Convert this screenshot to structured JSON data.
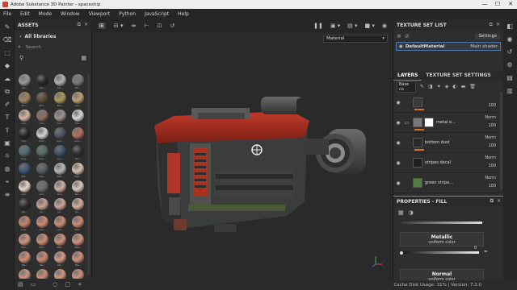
{
  "window": {
    "title": "Adobe Substance 3D Painter - spaceship",
    "min": "—",
    "max": "☐",
    "close": "✕"
  },
  "menu": [
    "File",
    "Edit",
    "Mode",
    "Window",
    "Viewport",
    "Python",
    "JavaScript",
    "Help"
  ],
  "assets": {
    "title": "ASSETS",
    "library": "All libraries",
    "search_placeholder": "Search",
    "items": [
      {
        "label": "Alu...",
        "color": "#9a9a9a"
      },
      {
        "label": "Alu...",
        "color": "#2a2a2a"
      },
      {
        "label": "Alu...",
        "color": "#b0b0b0"
      },
      {
        "label": "Alu...",
        "color": "#7c7c7c"
      },
      {
        "label": "Bro...",
        "color": "#a4855d"
      },
      {
        "label": "Bro...",
        "color": "#5a4a36"
      },
      {
        "label": "Bro...",
        "color": "#a89a55"
      },
      {
        "label": "Car...",
        "color": "#c0a070"
      },
      {
        "label": "Car...",
        "color": "#d6b8a3"
      },
      {
        "label": "Cel...",
        "color": "#8c6f62"
      },
      {
        "label": "Cel...",
        "color": "#9d938e"
      },
      {
        "label": "Chr...",
        "color": "#d8d8d8"
      },
      {
        "label": "Chr...",
        "color": "#272727"
      },
      {
        "label": "Cob...",
        "color": "#d2d2d2"
      },
      {
        "label": "Cob...",
        "color": "#4d5463"
      },
      {
        "label": "Cop...",
        "color": "#b0705c"
      },
      {
        "label": "Cop...",
        "color": "#4e6c74"
      },
      {
        "label": "Cop...",
        "color": "#556b66"
      },
      {
        "label": "Cyc...",
        "color": "#3c5468"
      },
      {
        "label": "Dir...",
        "color": "#2f3033"
      },
      {
        "label": "Ele...",
        "color": "#3d5775"
      },
      {
        "label": "Fab...",
        "color": "#5a5d60"
      },
      {
        "label": "Fab...",
        "color": "#b9b9b9"
      },
      {
        "label": "Fab...",
        "color": "#d5c1b0"
      },
      {
        "label": "Gla...",
        "color": "#e9d5c8"
      },
      {
        "label": "Gol...",
        "color": "#6e6e6e"
      },
      {
        "label": "Gol...",
        "color": "#cfaea0"
      },
      {
        "label": "Gri...",
        "color": "#d9c6bc"
      },
      {
        "label": "Gri...",
        "color": "#2c2c2c"
      },
      {
        "label": "Iro...",
        "color": "#c8a28f"
      },
      {
        "label": "Iro...",
        "color": "#cba696"
      },
      {
        "label": "Iro...",
        "color": "#d3ae99"
      },
      {
        "label": "Lea...",
        "color": "#c98268"
      },
      {
        "label": "Lea...",
        "color": "#d08a71"
      },
      {
        "label": "Lea...",
        "color": "#cf8b72"
      },
      {
        "label": "Met...",
        "color": "#c98a73"
      },
      {
        "label": "Met...",
        "color": "#d0957e"
      },
      {
        "label": "Met...",
        "color": "#cd8c73"
      },
      {
        "label": "Met...",
        "color": "#cf9179"
      },
      {
        "label": "Met...",
        "color": "#d19681"
      },
      {
        "label": "Pai...",
        "color": "#d08e75"
      },
      {
        "label": "Pai...",
        "color": "#c88970"
      },
      {
        "label": "Pai...",
        "color": "#d39a86"
      },
      {
        "label": "Pla...",
        "color": "#cf8f78"
      },
      {
        "label": "Pla...",
        "color": "#d09580"
      },
      {
        "label": "Pla...",
        "color": "#cc8c74"
      },
      {
        "label": "Rub...",
        "color": "#d2957d"
      },
      {
        "label": "Rus...",
        "color": "#cf917a"
      }
    ]
  },
  "viewport": {
    "material_select": "Material"
  },
  "texture_set_list": {
    "title": "TEXTURE SET LIST",
    "settings": "Settings",
    "item_name": "DefaultMaterial",
    "shader": "Main shader"
  },
  "layers_panel": {
    "tab_layers": "LAYERS",
    "tab_tss": "TEXTURE SET SETTINGS",
    "blend": "Base co",
    "layers": [
      {
        "name": "",
        "blend": "",
        "opacity": "100",
        "thumb": "#3a3a3a",
        "mask": false,
        "folder": false,
        "bar": true
      },
      {
        "name": "metal e...",
        "blend": "Norm",
        "opacity": "100",
        "thumb": "#777",
        "mask": true,
        "folder": true,
        "bar": true
      },
      {
        "name": "bottom dust",
        "blend": "Norm",
        "opacity": "100",
        "thumb": "#2a2a2a",
        "mask": false,
        "folder": false,
        "bar": true
      },
      {
        "name": "stripes decal",
        "blend": "Norm",
        "opacity": "100",
        "thumb": "#1e1e1e",
        "mask": false,
        "folder": false,
        "bar": false
      },
      {
        "name": "green stripe...",
        "blend": "Norm",
        "opacity": "100",
        "thumb": "#4f7f3c",
        "mask": false,
        "folder": false,
        "bar": false
      }
    ]
  },
  "properties": {
    "title": "PROPERTIES - FILL",
    "metallic": {
      "title": "Metallic",
      "subtitle": "uniform color",
      "value": "0",
      "fraction": 0.0
    },
    "normal": {
      "title": "Normal",
      "subtitle": "uniform color",
      "color": "#8080ff"
    }
  },
  "status": {
    "cache": "Cache Disk Usage: 31% | Version: 7.2.0"
  }
}
